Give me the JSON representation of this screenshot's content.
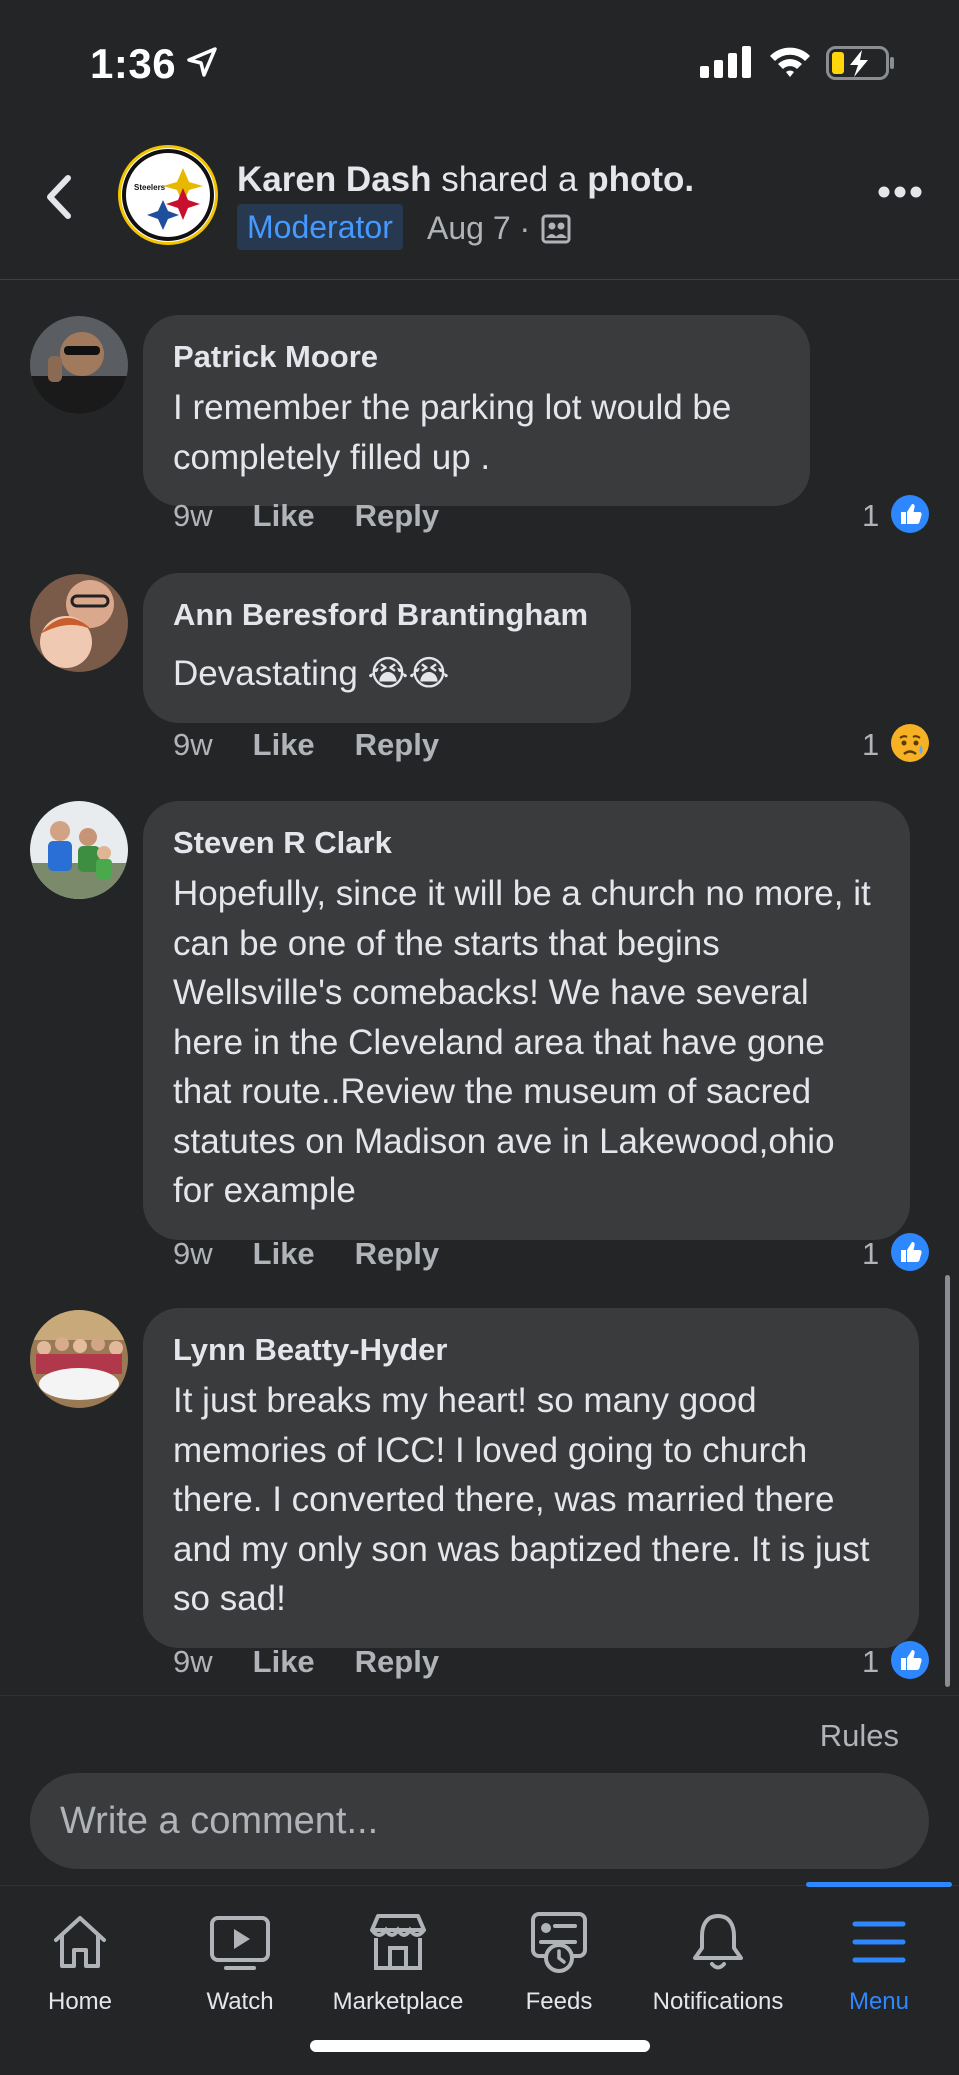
{
  "status_bar": {
    "time": "1:36"
  },
  "header": {
    "author": "Karen Dash",
    "verb": " shared a ",
    "object": "photo.",
    "badge": "Moderator",
    "date": "Aug 7 ·"
  },
  "comments": [
    {
      "name": "Patrick Moore",
      "text": "I remember the parking lot would be completely filled up .",
      "age": "9w",
      "like": "Like",
      "reply": "Reply",
      "reaction_count": "1",
      "reaction": "like-reaction-icon"
    },
    {
      "name": "Ann Beresford Brantingham",
      "text": "Devastating 😭😭",
      "age": "9w",
      "like": "Like",
      "reply": "Reply",
      "reaction_count": "1",
      "reaction": "sad-reaction-icon"
    },
    {
      "name": "Steven R Clark",
      "text": "Hopefully, since it will be a church no more, it can be one of the starts that begins Wellsville's comebacks!  We have several here in the Cleveland area that have gone that route..Review the museum of sacred statutes on Madison ave in Lakewood,ohio for example",
      "age": "9w",
      "like": "Like",
      "reply": "Reply",
      "reaction_count": "1",
      "reaction": "like-reaction-icon"
    },
    {
      "name": "Lynn Beatty-Hyder",
      "text": "It just breaks my heart! so many good memories of ICC! I loved going to church there. I converted there, was married there and my only son was baptized there. It is just so sad!",
      "age": "9w",
      "like": "Like",
      "reply": "Reply",
      "reaction_count": "1",
      "reaction": "like-reaction-icon"
    }
  ],
  "composer": {
    "rules": "Rules",
    "placeholder": "Write a comment..."
  },
  "tabs": [
    {
      "label": "Home",
      "icon": "home-icon"
    },
    {
      "label": "Watch",
      "icon": "watch-icon"
    },
    {
      "label": "Marketplace",
      "icon": "marketplace-icon"
    },
    {
      "label": "Feeds",
      "icon": "feeds-icon"
    },
    {
      "label": "Notifications",
      "icon": "bell-icon"
    },
    {
      "label": "Menu",
      "icon": "menu-icon",
      "active": true
    }
  ],
  "colors": {
    "background": "#242526",
    "bubble": "#3a3b3c",
    "accent": "#2d88ff",
    "muted_text": "#b0b3b8"
  }
}
